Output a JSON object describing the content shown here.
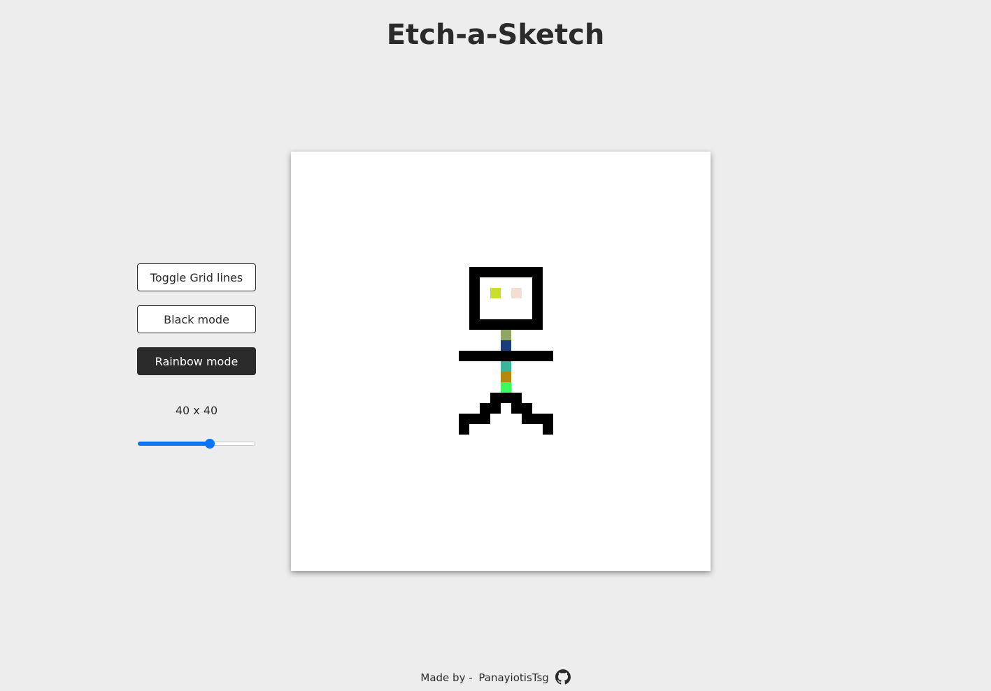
{
  "header": {
    "title": "Etch-a-Sketch"
  },
  "controls": {
    "toggle_grid_label": "Toggle Grid lines",
    "black_mode_label": "Black mode",
    "rainbow_mode_label": "Rainbow mode",
    "active_mode": "rainbow",
    "grid_size_label": "40 x 40",
    "grid_size": 40,
    "slider_min": 1,
    "slider_max": 64,
    "slider_value": 40
  },
  "board": {
    "rows": 40,
    "cols": 40,
    "background": "#ffffff",
    "pixels": [
      {
        "r": 11,
        "c": 17,
        "w": 7,
        "h": 1,
        "color": "#000000"
      },
      {
        "r": 12,
        "c": 17,
        "w": 1,
        "h": 4,
        "color": "#000000"
      },
      {
        "r": 12,
        "c": 23,
        "w": 1,
        "h": 4,
        "color": "#000000"
      },
      {
        "r": 16,
        "c": 17,
        "w": 7,
        "h": 1,
        "color": "#000000"
      },
      {
        "r": 13,
        "c": 19,
        "w": 1,
        "h": 1,
        "color": "#c9dd2d"
      },
      {
        "r": 13,
        "c": 21,
        "w": 1,
        "h": 1,
        "color": "#f6ddd1"
      },
      {
        "r": 17,
        "c": 20,
        "w": 1,
        "h": 1,
        "color": "#8fa664"
      },
      {
        "r": 18,
        "c": 20,
        "w": 1,
        "h": 1,
        "color": "#1c3b78"
      },
      {
        "r": 19,
        "c": 16,
        "w": 9,
        "h": 1,
        "color": "#000000"
      },
      {
        "r": 20,
        "c": 20,
        "w": 1,
        "h": 1,
        "color": "#3bb49a"
      },
      {
        "r": 21,
        "c": 20,
        "w": 1,
        "h": 1,
        "color": "#b3880d"
      },
      {
        "r": 22,
        "c": 20,
        "w": 1,
        "h": 1,
        "color": "#3dfa5c"
      },
      {
        "r": 23,
        "c": 19,
        "w": 3,
        "h": 1,
        "color": "#000000"
      },
      {
        "r": 24,
        "c": 18,
        "w": 2,
        "h": 1,
        "color": "#000000"
      },
      {
        "r": 24,
        "c": 21,
        "w": 2,
        "h": 1,
        "color": "#000000"
      },
      {
        "r": 25,
        "c": 16,
        "w": 3,
        "h": 1,
        "color": "#000000"
      },
      {
        "r": 25,
        "c": 22,
        "w": 3,
        "h": 1,
        "color": "#000000"
      },
      {
        "r": 26,
        "c": 16,
        "w": 1,
        "h": 1,
        "color": "#000000"
      },
      {
        "r": 26,
        "c": 24,
        "w": 1,
        "h": 1,
        "color": "#000000"
      }
    ]
  },
  "footer": {
    "made_by_text": "Made by -",
    "author_link": "PanayiotisTsg",
    "icon": "github-icon"
  },
  "colors": {
    "page_background": "#ededed",
    "text": "#2b2b2b",
    "accent": "#0a75f2",
    "active_button": "#2b2b2b"
  }
}
